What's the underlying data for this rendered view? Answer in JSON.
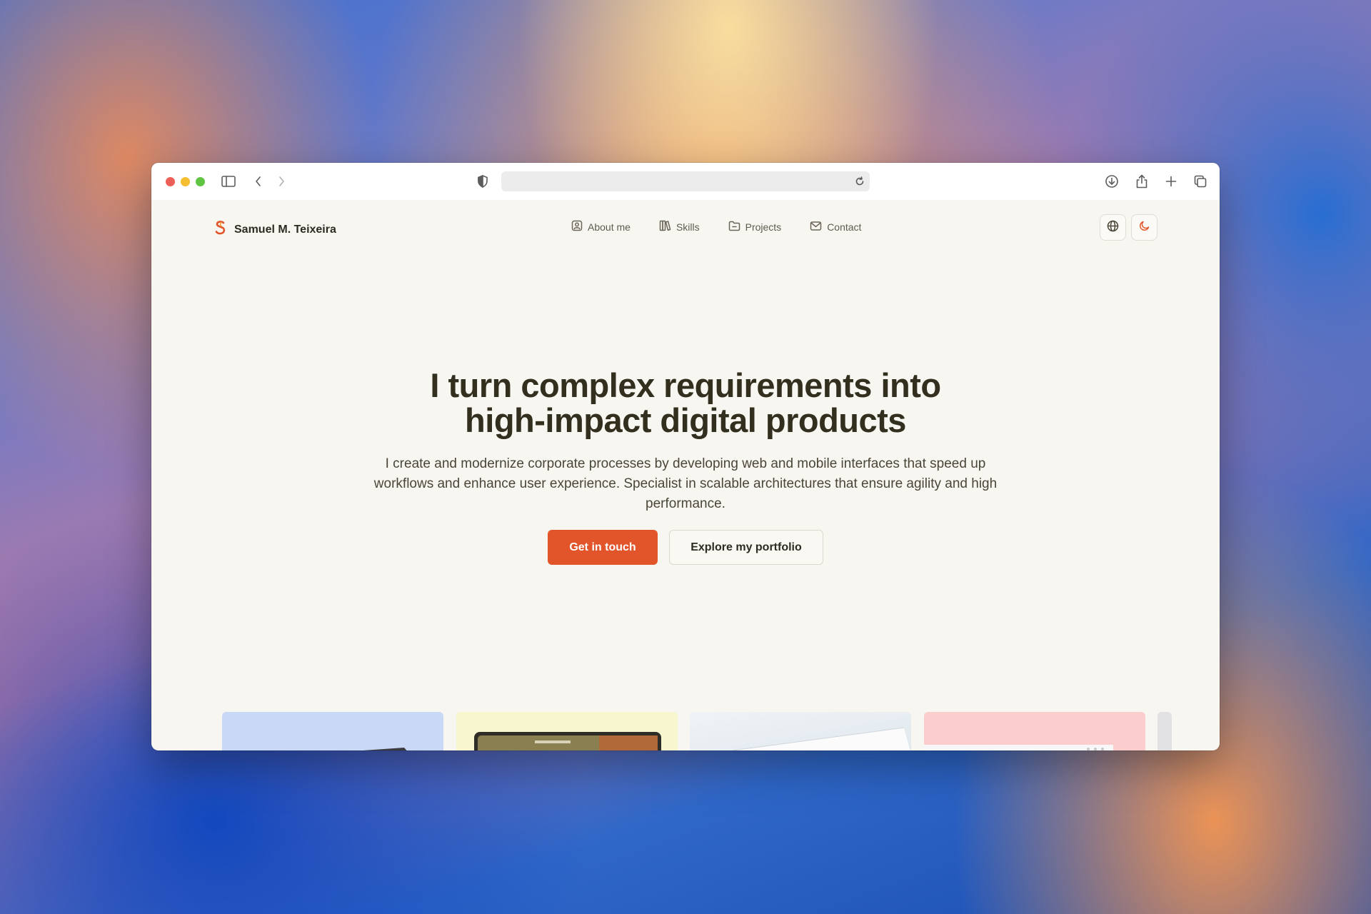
{
  "browser": {
    "address_value": ""
  },
  "site": {
    "brand_name": "Samuel M. Teixeira",
    "nav": [
      {
        "label": "About me",
        "icon": "user-card-icon"
      },
      {
        "label": "Skills",
        "icon": "books-icon"
      },
      {
        "label": "Projects",
        "icon": "folder-icon"
      },
      {
        "label": "Contact",
        "icon": "mail-icon"
      }
    ],
    "actions": {
      "language_icon": "globe-icon",
      "theme_icon": "moon-icon"
    }
  },
  "hero": {
    "title_line1": "I turn complex requirements into",
    "title_line2": "high-impact digital products",
    "subtitle": "I create and modernize corporate processes by developing web and mobile interfaces that speed up workflows and enhance user experience. Specialist in scalable architectures that ensure agility and high performance.",
    "primary_cta": "Get in touch",
    "secondary_cta": "Explore my portfolio"
  },
  "colors": {
    "accent": "#e2542a",
    "text_dark": "#332f1f",
    "page_bg": "#f8f6f1"
  }
}
